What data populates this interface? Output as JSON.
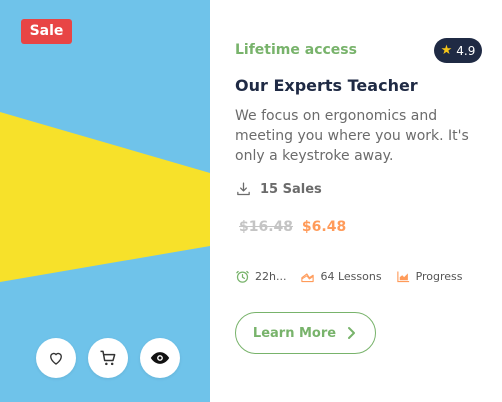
{
  "badge": {
    "sale": "Sale"
  },
  "course": {
    "access": "Lifetime access",
    "rating": "4.9",
    "title": "Our Experts Teacher",
    "description": "We focus on ergonomics and meeting you where you work. It's only a keystroke away.",
    "sales": "15 Sales",
    "price_old": "$16.48",
    "price_new": "$6.48",
    "duration": "22h...",
    "lessons": "64 Lessons",
    "level": "Progress",
    "cta": "Learn More"
  },
  "icons": {
    "wishlist": "heart-icon",
    "cart": "cart-icon",
    "preview": "eye-icon",
    "rating": "star-icon",
    "sales": "download-icon",
    "duration": "clock-icon",
    "lessons": "layers-icon",
    "level": "chart-icon",
    "cta": "chevron-right-icon"
  },
  "colors": {
    "accent": "#78b36b",
    "sale": "#e84545",
    "price_new": "#ff9b5a",
    "rating_bg": "#1f2a44",
    "media_blue": "#6fc3ea",
    "media_yellow": "#f7e12a"
  }
}
